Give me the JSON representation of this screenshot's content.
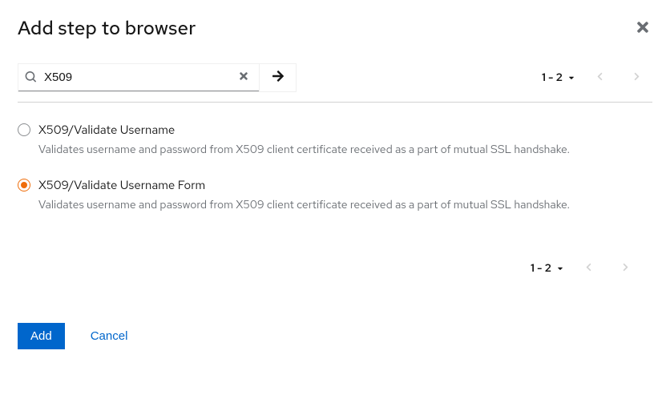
{
  "header": {
    "title": "Add step to browser"
  },
  "search": {
    "value": "X509",
    "placeholder": ""
  },
  "pagination_top": {
    "range": "1 - 2"
  },
  "pagination_bottom": {
    "range": "1 - 2"
  },
  "options": [
    {
      "title": "X509/Validate Username",
      "description": "Validates username and password from X509 client certificate received as a part of mutual SSL handshake.",
      "selected": false
    },
    {
      "title": "X509/Validate Username Form",
      "description": "Validates username and password from X509 client certificate received as a part of mutual SSL handshake.",
      "selected": true
    }
  ],
  "footer": {
    "add": "Add",
    "cancel": "Cancel"
  }
}
